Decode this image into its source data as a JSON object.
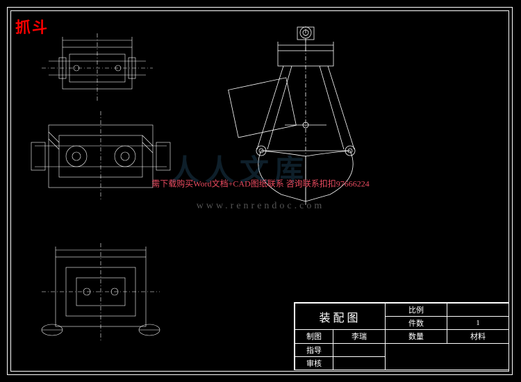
{
  "title": "抓斗",
  "watermark": {
    "text": "需下载购买Word文档+CAD图纸联系 咨询联系扣扣97666224",
    "url": "www.renrendoc.com",
    "logo": "人人文库"
  },
  "title_block": {
    "main_title": "装配图",
    "rows": {
      "scale_label": "比例",
      "scale_value": "",
      "parts_label": "件数",
      "parts_value": "1",
      "qty_label": "数量",
      "material_label": "材料",
      "draw_label": "制图",
      "draw_value": "李瑞",
      "guide_label": "指导",
      "review_label": "审核"
    }
  },
  "chart_data": {
    "type": "diagram",
    "title": "抓斗 装配图 (Grab Bucket Assembly Drawing)",
    "views": [
      {
        "name": "top-view",
        "position": "upper-left",
        "desc": "plan view of grab mechanism upper assembly"
      },
      {
        "name": "side-section",
        "position": "mid-left",
        "desc": "sectional side elevation of sheave block"
      },
      {
        "name": "front-view",
        "position": "lower-left",
        "desc": "front elevation of lower cross-beam assembly"
      },
      {
        "name": "iso-assembly",
        "position": "upper-right",
        "desc": "closed grab bucket shell with arms, pins and lifting eye"
      }
    ]
  }
}
